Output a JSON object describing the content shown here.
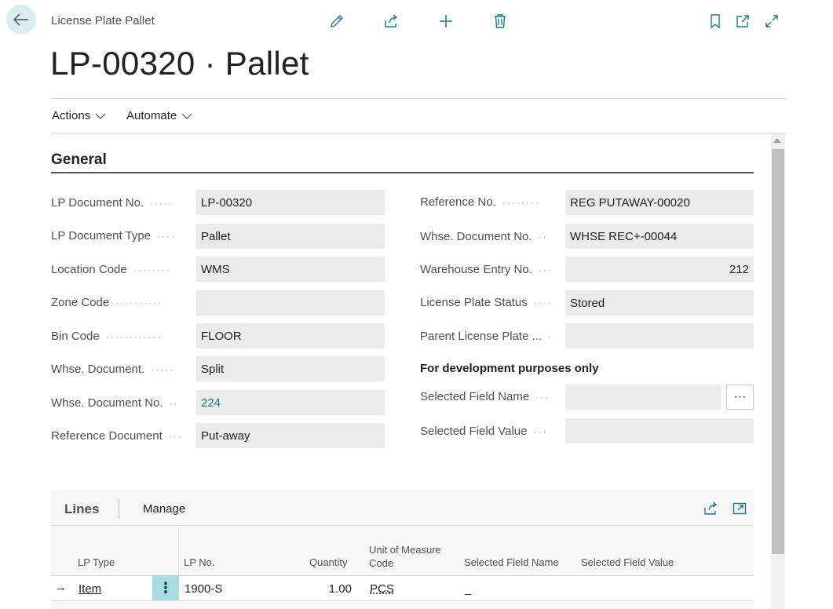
{
  "header": {
    "breadcrumb": "License Plate Pallet",
    "title_no": "LP-00320",
    "title_sep": " · ",
    "title_type": "Pallet"
  },
  "toolbar": {
    "icons": [
      "edit-icon",
      "share-icon",
      "add-icon",
      "delete-icon",
      "bookmark-icon",
      "open-new-window-icon",
      "expand-icon"
    ]
  },
  "menu": {
    "actions_label": "Actions",
    "automate_label": "Automate"
  },
  "general": {
    "title": "General",
    "left_fields": [
      {
        "label": "LP Document No.",
        "value": "LP-00320"
      },
      {
        "label": "LP Document Type",
        "value": "Pallet"
      },
      {
        "label": "Location Code",
        "value": "WMS"
      },
      {
        "label": "Zone Code",
        "value": ""
      },
      {
        "label": "Bin Code",
        "value": "FLOOR"
      },
      {
        "label": "Whse. Document.",
        "value": "Split"
      },
      {
        "label": "Whse. Document No.",
        "value": "224"
      },
      {
        "label": "Reference Document",
        "value": "Put-away"
      }
    ],
    "right_fields": [
      {
        "label": "Reference No.",
        "value": "REG PUTAWAY-00020"
      },
      {
        "label": "Whse. Document No.",
        "value": "WHSE REC+-00044"
      },
      {
        "label": "Warehouse Entry No.",
        "value": "212"
      },
      {
        "label": "License Plate Status",
        "value": "Stored"
      },
      {
        "label": "Parent License Plate ...",
        "value": ""
      }
    ],
    "dev_title": "For development purposes only",
    "dev_fields": [
      {
        "label": "Selected Field Name",
        "value": ""
      },
      {
        "label": "Selected Field Value",
        "value": ""
      }
    ],
    "dots_label": "···"
  },
  "lines": {
    "title": "Lines",
    "manage_label": "Manage",
    "columns": {
      "lp_type": "LP Type",
      "lp_no": "LP No.",
      "quantity": "Quantity",
      "uom_line1": "Unit of Measure",
      "uom_line2": "Code",
      "sel_name": "Selected Field Name",
      "sel_value": "Selected Field Value"
    },
    "rows": [
      {
        "lp_type": "Item",
        "lp_no": "1900-S",
        "quantity": "1.00",
        "uom": "PCS",
        "sel_name": "_",
        "sel_value": ""
      }
    ],
    "row_arrow": "→",
    "row_menu": "⋮"
  },
  "colors": {
    "accent": "#1a7a8c",
    "back_bg": "#d9eef0",
    "row_menu_bg": "#a7dde2"
  }
}
